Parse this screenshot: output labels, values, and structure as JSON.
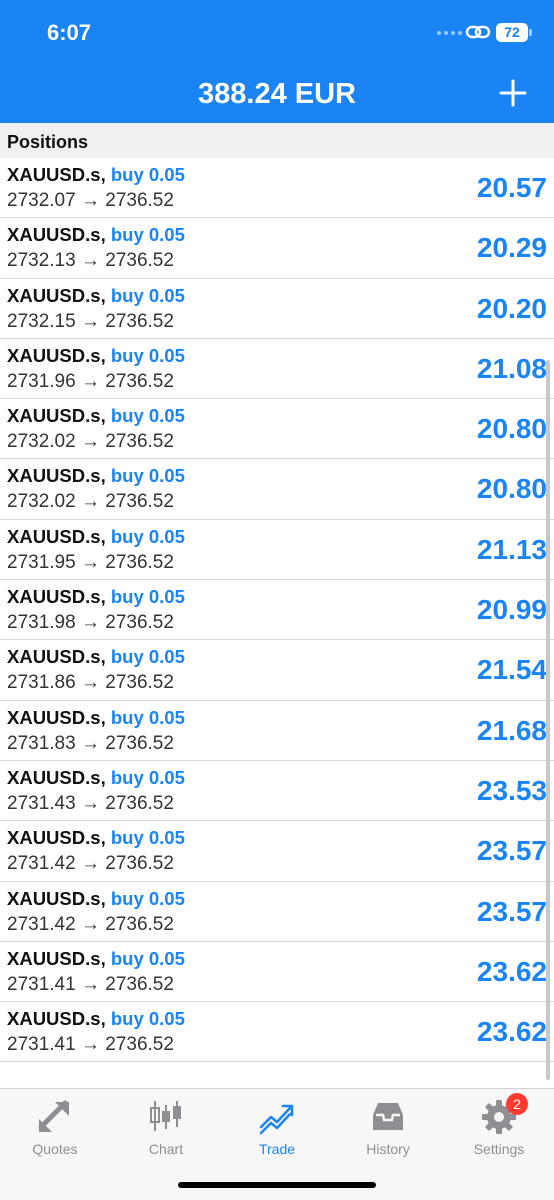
{
  "status": {
    "time": "6:07",
    "battery": "72"
  },
  "header": {
    "balance": "388.24 EUR",
    "add_label": "+"
  },
  "section": {
    "title": "Positions"
  },
  "positions": [
    {
      "symbol": "XAUUSD.s",
      "side": "buy 0.05",
      "open": "2732.07",
      "current": "2736.52",
      "profit": "20.57"
    },
    {
      "symbol": "XAUUSD.s",
      "side": "buy 0.05",
      "open": "2732.13",
      "current": "2736.52",
      "profit": "20.29"
    },
    {
      "symbol": "XAUUSD.s",
      "side": "buy 0.05",
      "open": "2732.15",
      "current": "2736.52",
      "profit": "20.20"
    },
    {
      "symbol": "XAUUSD.s",
      "side": "buy 0.05",
      "open": "2731.96",
      "current": "2736.52",
      "profit": "21.08"
    },
    {
      "symbol": "XAUUSD.s",
      "side": "buy 0.05",
      "open": "2732.02",
      "current": "2736.52",
      "profit": "20.80"
    },
    {
      "symbol": "XAUUSD.s",
      "side": "buy 0.05",
      "open": "2732.02",
      "current": "2736.52",
      "profit": "20.80"
    },
    {
      "symbol": "XAUUSD.s",
      "side": "buy 0.05",
      "open": "2731.95",
      "current": "2736.52",
      "profit": "21.13"
    },
    {
      "symbol": "XAUUSD.s",
      "side": "buy 0.05",
      "open": "2731.98",
      "current": "2736.52",
      "profit": "20.99"
    },
    {
      "symbol": "XAUUSD.s",
      "side": "buy 0.05",
      "open": "2731.86",
      "current": "2736.52",
      "profit": "21.54"
    },
    {
      "symbol": "XAUUSD.s",
      "side": "buy 0.05",
      "open": "2731.83",
      "current": "2736.52",
      "profit": "21.68"
    },
    {
      "symbol": "XAUUSD.s",
      "side": "buy 0.05",
      "open": "2731.43",
      "current": "2736.52",
      "profit": "23.53"
    },
    {
      "symbol": "XAUUSD.s",
      "side": "buy 0.05",
      "open": "2731.42",
      "current": "2736.52",
      "profit": "23.57"
    },
    {
      "symbol": "XAUUSD.s",
      "side": "buy 0.05",
      "open": "2731.42",
      "current": "2736.52",
      "profit": "23.57"
    },
    {
      "symbol": "XAUUSD.s",
      "side": "buy 0.05",
      "open": "2731.41",
      "current": "2736.52",
      "profit": "23.62"
    },
    {
      "symbol": "XAUUSD.s",
      "side": "buy 0.05",
      "open": "2731.41",
      "current": "2736.52",
      "profit": "23.62"
    }
  ],
  "tabs": [
    {
      "label": "Quotes",
      "icon": "quotes-icon"
    },
    {
      "label": "Chart",
      "icon": "chart-icon"
    },
    {
      "label": "Trade",
      "icon": "trade-icon",
      "active": true
    },
    {
      "label": "History",
      "icon": "history-icon"
    },
    {
      "label": "Settings",
      "icon": "settings-icon",
      "badge": "2"
    }
  ],
  "colors": {
    "accent": "#1a84f5",
    "badge": "#ff3b30",
    "inactive": "#8e8e93"
  }
}
